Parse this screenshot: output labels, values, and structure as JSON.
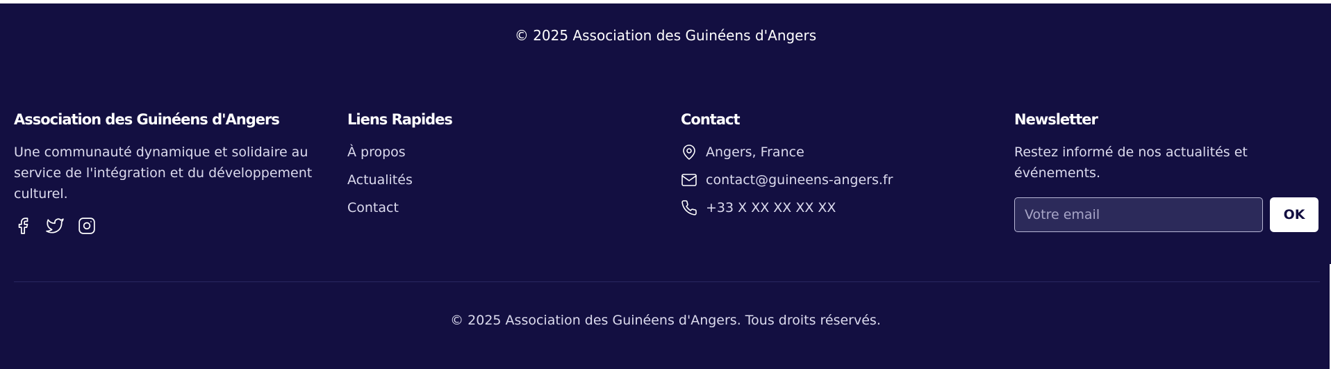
{
  "top_copyright": "© 2025 Association des Guinéens d'Angers",
  "about": {
    "title": "Association des Guinéens d'Angers",
    "description": "Une communauté dynamique et solidaire au service de l'intégration et du développement culturel.",
    "social_icons": [
      "facebook-icon",
      "twitter-icon",
      "instagram-icon"
    ]
  },
  "quick_links": {
    "title": "Liens Rapides",
    "items": [
      {
        "label": "À propos"
      },
      {
        "label": "Actualités"
      },
      {
        "label": "Contact"
      }
    ]
  },
  "contact": {
    "title": "Contact",
    "location": "Angers, France",
    "email": "contact@guineens-angers.fr",
    "phone": "+33 X XX XX XX XX"
  },
  "newsletter": {
    "title": "Newsletter",
    "description": "Restez informé de nos actualités et événements.",
    "email_placeholder": "Votre email",
    "email_value": "",
    "submit_label": "OK"
  },
  "bottom_copyright": "© 2025 Association des Guinéens d'Angers. Tous droits réservés.",
  "colors": {
    "background": "#130f41",
    "text": "#ffffff",
    "muted_text": "#dcdbee",
    "input_bg": "#2c2a5a"
  }
}
